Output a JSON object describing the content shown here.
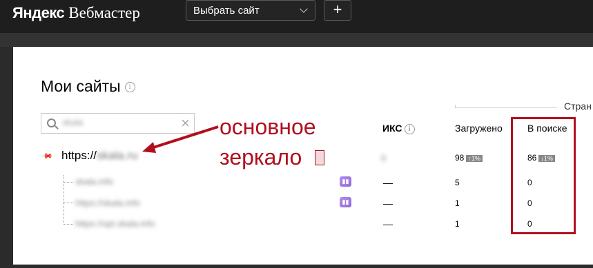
{
  "header": {
    "logo_brand": "Яндекс",
    "logo_product": "Вебмастер",
    "site_select_label": "Выбрать сайт",
    "add_label": "+"
  },
  "page": {
    "title": "Мои сайты",
    "info_glyph": "i"
  },
  "search": {
    "value": "skala",
    "clear_glyph": "×"
  },
  "columns": {
    "iks": "ИКС",
    "pages_group": "Стран",
    "loaded": "Загружено",
    "in_search": "В поиске"
  },
  "main_site": {
    "url_prefix": "https://",
    "url_rest": "skala.ru",
    "iks": "0",
    "loaded": "98",
    "loaded_change": "↑1%",
    "in_search": "86",
    "in_search_change": "↓1%"
  },
  "mirrors": [
    {
      "url": "skala.info",
      "iks": "—",
      "loaded": "5",
      "in_search": "0",
      "metrica": true
    },
    {
      "url": "https://skala.info",
      "iks": "—",
      "loaded": "1",
      "in_search": "0",
      "metrica": true
    },
    {
      "url": "https://opt.skala.info",
      "iks": "—",
      "loaded": "1",
      "in_search": "0",
      "metrica": false
    }
  ],
  "annotation": {
    "line1": "основное",
    "line2": "зеркало",
    "color": "#b10f1f"
  }
}
